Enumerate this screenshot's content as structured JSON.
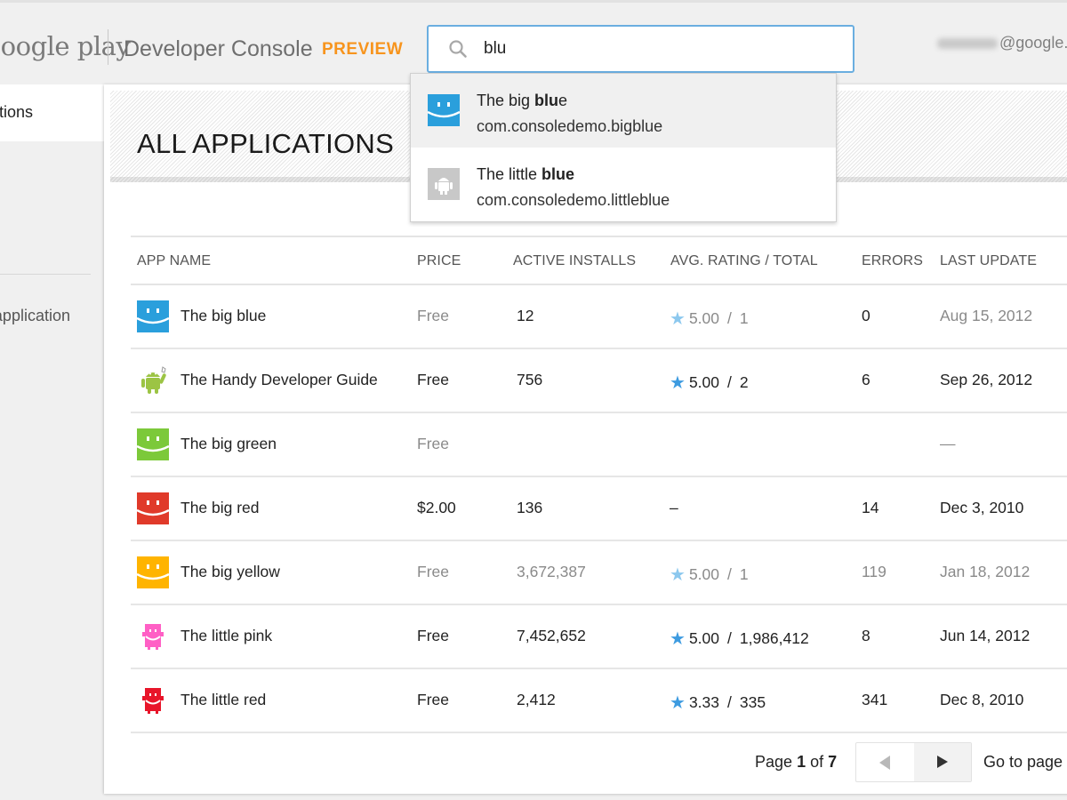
{
  "header": {
    "logo_text": "Google play",
    "console_title": "Developer Console",
    "preview_badge": "PREVIEW",
    "account_suffix": "@google.",
    "search": {
      "value": "blu",
      "icon": "search-icon"
    }
  },
  "sidebar": {
    "items": [
      {
        "label": "All applications",
        "active": true
      },
      {
        "label": "Add new application",
        "active": false
      }
    ]
  },
  "main": {
    "title": "ALL APPLICATIONS",
    "columns": [
      "APP NAME",
      "PRICE",
      "ACTIVE INSTALLS",
      "AVG. RATING / TOTAL",
      "ERRORS",
      "LAST UPDATE"
    ],
    "rows": [
      {
        "icon": "smiley-blue-icon",
        "name": "The big blue",
        "price": "Free",
        "installs": "12",
        "rating": "5.00",
        "rating_total": "1",
        "errors": "0",
        "last_update": "Aug 15, 2012",
        "style": "muted"
      },
      {
        "icon": "android-robot-icon",
        "name": "The Handy Developer Guide",
        "price": "Free",
        "installs": "756",
        "rating": "5.00",
        "rating_total": "2",
        "errors": "6",
        "last_update": "Sep 26, 2012",
        "style": "strong"
      },
      {
        "icon": "smiley-green-icon",
        "name": "The big green",
        "price": "Free",
        "installs": "",
        "rating": "",
        "rating_total": "",
        "errors": "",
        "last_update": "—",
        "style": "muted"
      },
      {
        "icon": "smiley-red-icon",
        "name": "The big red",
        "price": "$2.00",
        "installs": "136",
        "rating": "–",
        "rating_total": "",
        "errors": "14",
        "last_update": "Dec 3, 2010",
        "style": "strong"
      },
      {
        "icon": "smiley-yellow-icon",
        "name": "The big yellow",
        "price": "Free",
        "installs": "3,672,387",
        "rating": "5.00",
        "rating_total": "1",
        "errors": "119",
        "last_update": "Jan 18, 2012",
        "style": "muted"
      },
      {
        "icon": "robot-pink-icon",
        "name": "The little pink",
        "price": "Free",
        "installs": "7,452,652",
        "rating": "5.00",
        "rating_total": "1,986,412",
        "errors": "8",
        "last_update": "Jun 14, 2012",
        "style": "strong"
      },
      {
        "icon": "robot-red-icon",
        "name": "The little red",
        "price": "Free",
        "installs": "2,412",
        "rating": "3.33",
        "rating_total": "335",
        "errors": "341",
        "last_update": "Dec 8, 2010",
        "style": "strong"
      }
    ],
    "pagination": {
      "page_prefix": "Page",
      "current": "1",
      "of": "of",
      "total": "7",
      "goto_label": "Go to page"
    }
  },
  "search_suggestions": [
    {
      "title_prefix": "The big ",
      "title_match": "blu",
      "title_suffix": "e",
      "package": "com.consoledemo.bigblue",
      "icon": "smiley-blue-icon",
      "highlighted": true
    },
    {
      "title_prefix": "The little ",
      "title_match": "blue",
      "title_suffix": "",
      "package": "com.consoledemo.littleblue",
      "icon": "android-placeholder-icon",
      "highlighted": false
    }
  ],
  "colors": {
    "accent_blue": "#3d9be0",
    "preview_orange": "#f7941d",
    "search_border": "#6aaee0",
    "icon_blue": "#2a9fdc",
    "icon_green": "#7cc93a",
    "icon_red": "#e03a2a",
    "icon_yellow": "#ffb400",
    "icon_pink": "#ff5fc5",
    "icon_little_red": "#e8152a"
  }
}
